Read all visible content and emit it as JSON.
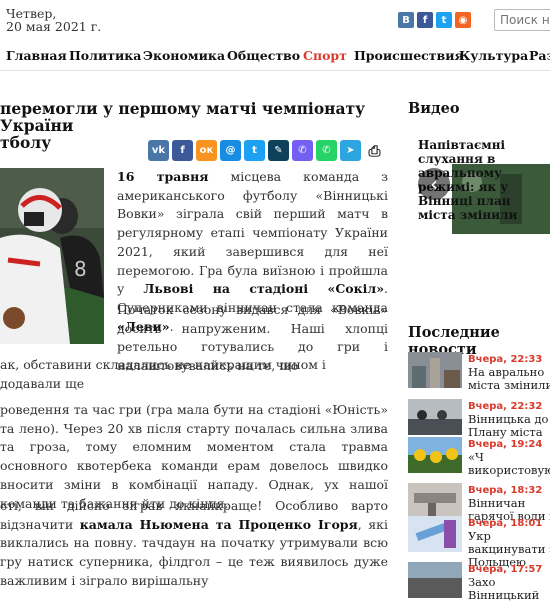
{
  "header": {
    "date_line1": "Четвер,",
    "date_line2": "20 мая 2021 г.",
    "search_placeholder": "Поиск но",
    "social": [
      {
        "icon": "vk-icon",
        "glyph": "В",
        "color": "#4a76a8"
      },
      {
        "icon": "facebook-icon",
        "glyph": "f",
        "color": "#3b5998"
      },
      {
        "icon": "twitter-icon",
        "glyph": "t",
        "color": "#1da1f2"
      },
      {
        "icon": "rss-icon",
        "glyph": "◉",
        "color": "#f26522"
      }
    ]
  },
  "nav": {
    "items": [
      "Главная",
      "Политика",
      "Экономика",
      "Общество",
      "Спорт",
      "Происшествия",
      "Культура",
      "Разн"
    ],
    "active": "Спорт"
  },
  "article": {
    "title_line1": "ЕРЕМОГЛИ У ПЕРШОМУ МАТЧІ ЧЕМПІОНАТУ УКРАЇНИ",
    "title_text_1": "перемогли у першому матчі чемпіонату України",
    "title_text_2": "тболу",
    "share_icons": [
      {
        "icon": "vk-share-icon",
        "glyph": "vk",
        "color": "#4a76a8"
      },
      {
        "icon": "facebook-share-icon",
        "glyph": "f",
        "color": "#3b5998"
      },
      {
        "icon": "odnoklassniki-share-icon",
        "glyph": "ок",
        "color": "#f7931e"
      },
      {
        "icon": "mymail-share-icon",
        "glyph": "@",
        "color": "#168de2"
      },
      {
        "icon": "twitter-share-icon",
        "glyph": "t",
        "color": "#1da1f2"
      },
      {
        "icon": "livejournal-share-icon",
        "glyph": "✎",
        "color": "#0d425a"
      },
      {
        "icon": "viber-share-icon",
        "glyph": "✆",
        "color": "#7360f2"
      },
      {
        "icon": "whatsapp-share-icon",
        "glyph": "✆",
        "color": "#25d366"
      },
      {
        "icon": "telegram-share-icon",
        "glyph": "➤",
        "color": "#2ca5e0"
      },
      {
        "icon": "print-icon",
        "glyph": "⎙",
        "color": "#ffffff"
      }
    ],
    "p1_lead": "16 травня",
    "p1_a": " місцева команда з американського футболу «Вінницькі Вовки» зіграла свій перший матч в регулярному етапі чемпіонату України 2021, який завершився для неї перемогою. Гра була виїзною і пройшла у ",
    "p1_b": "Львові на стадіоні «Сокіл»",
    "p1_c": ". Суперниками вінничан стала команда ",
    "p1_d": "«Леви»",
    "p1_e": ".",
    "p2_a": "Початок сезону видався для «Вовків» досить напруженим. Наші хлопці ретельно готувались до гри і налаштовувались на те, що",
    "p2_b": "ак, обставини складались не найкращим чином і додавали ще",
    "p3": "роведення та час гри (гра мала бути на стадіоні «Юність» та лено). Через 20 хв після старту почалась сильна злива та гроза, тому еломним моментом стала травма основного квотербека команди ерам довелось швидко вносити зміни в комбінації нападу. Однак, ух нашої команди та бажання йти до кінця.",
    "p4_a": "сті, він дійсно зіграв якнайкраще! Особливо варто відзначити ",
    "p4_b": "камала Ньюмена та Проценко Ігоря",
    "p4_c": ", які виклались на повну. тачдаун на початку  утримували всю гру натиск суперника, філдгол – це теж виявилось дуже важливим і зіграло вирішальну"
  },
  "sidebar": {
    "video_heading": "Видео",
    "video_title": "Напівтаємні слухання в авральному режимі: як у Вінниці план міста змінили",
    "news_heading": "Последние новости",
    "news": [
      {
        "time": "Вчера, 22:33",
        "text": "На аврально міста змінили",
        "thumb": "city-thumb"
      },
      {
        "time": "Вчера, 22:32",
        "text": "Вінницька до Плану міста",
        "thumb": "meeting-thumb"
      },
      {
        "time": "Вчера, 19:24",
        "text": "«Ч використовую",
        "thumb": "sunflower-thumb"
      },
      {
        "time": "Вчера, 18:32",
        "text": "Вінничан гарячої води н",
        "thumb": "pipe-thumb"
      },
      {
        "time": "Вчера, 18:01",
        "text": "Укр вакцинувати з Польщею",
        "thumb": "vaccine-thumb"
      },
      {
        "time": "Вчера, 17:57",
        "text": "Захо Вінницький",
        "thumb": "road-thumb"
      }
    ]
  }
}
